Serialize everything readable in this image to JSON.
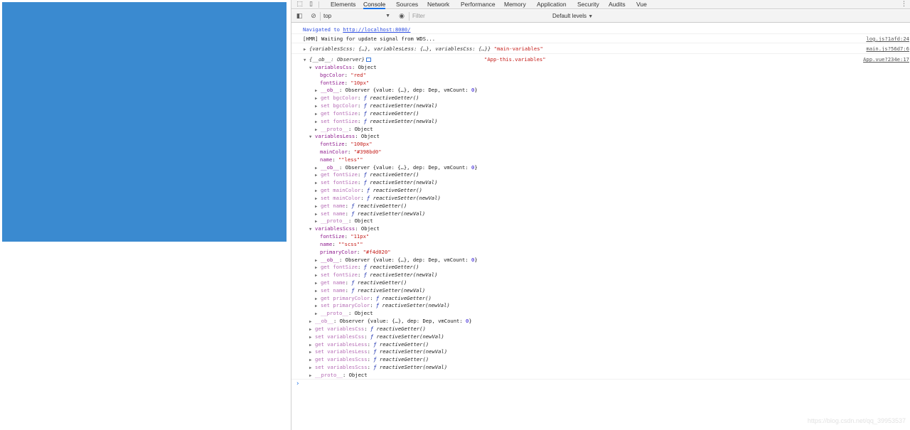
{
  "page": {
    "box_color": "#3a8ad0"
  },
  "devtools": {
    "tabs": [
      "Elements",
      "Console",
      "Sources",
      "Network",
      "Performance",
      "Memory",
      "Application",
      "Security",
      "Audits",
      "Vue"
    ],
    "active_tab": "Console",
    "toolbar": {
      "context": "top",
      "filter_placeholder": "Filter",
      "levels": "Default levels"
    }
  },
  "console": {
    "navigated": {
      "text": "Navigated to ",
      "url": "http://localhost:8080/"
    },
    "hmr": {
      "text": "[HMR] Waiting for update signal from WDS...",
      "source": "log.js?1afd:24"
    },
    "main_log": {
      "summary": "{variablesScss: {…}, variablesLess: {…}, variablesCss: {…}}",
      "label": "\"main-variables\"",
      "source": "main.js?56d7:6"
    },
    "app_log": {
      "summary": "{__ob__: Observer}",
      "label": "\"App-this.variables\"",
      "source": "App.vue?234e:17"
    },
    "tree": [
      {
        "indent": 1,
        "tri": "open",
        "key": "variablesCss",
        "value": ": Object"
      },
      {
        "indent": 2,
        "key": "bgcColor",
        "value": ": ",
        "str": "\"red\""
      },
      {
        "indent": 2,
        "key": "fontSize",
        "value": ": ",
        "str": "\"10px\""
      },
      {
        "indent": 2,
        "tri": "closed",
        "key": "__ob__",
        "value": ": Observer {value: {…}, dep: Dep, vmCount: ",
        "num": "0",
        "after": "}"
      },
      {
        "indent": 2,
        "tri": "closed",
        "dim": "get bgcColor",
        "value": ": ",
        "fsym": "ƒ",
        "fn": " reactiveGetter()"
      },
      {
        "indent": 2,
        "tri": "closed",
        "dim": "set bgcColor",
        "value": ": ",
        "fsym": "ƒ",
        "fn": " reactiveSetter(newVal)"
      },
      {
        "indent": 2,
        "tri": "closed",
        "dim": "get fontSize",
        "value": ": ",
        "fsym": "ƒ",
        "fn": " reactiveGetter()"
      },
      {
        "indent": 2,
        "tri": "closed",
        "dim": "set fontSize",
        "value": ": ",
        "fsym": "ƒ",
        "fn": " reactiveSetter(newVal)"
      },
      {
        "indent": 2,
        "tri": "closed",
        "dim": "__proto__",
        "value": ": Object"
      },
      {
        "indent": 1,
        "tri": "open",
        "key": "variablesLess",
        "value": ": Object"
      },
      {
        "indent": 2,
        "key": "fontSize",
        "value": ": ",
        "str": "\"100px\""
      },
      {
        "indent": 2,
        "key": "mainColor",
        "value": ": ",
        "str": "\"#398bd0\""
      },
      {
        "indent": 2,
        "key": "name",
        "value": ": ",
        "str": "\"\"less\"\""
      },
      {
        "indent": 2,
        "tri": "closed",
        "key": "__ob__",
        "value": ": Observer {value: {…}, dep: Dep, vmCount: ",
        "num": "0",
        "after": "}"
      },
      {
        "indent": 2,
        "tri": "closed",
        "dim": "get fontSize",
        "value": ": ",
        "fsym": "ƒ",
        "fn": " reactiveGetter()"
      },
      {
        "indent": 2,
        "tri": "closed",
        "dim": "set fontSize",
        "value": ": ",
        "fsym": "ƒ",
        "fn": " reactiveSetter(newVal)"
      },
      {
        "indent": 2,
        "tri": "closed",
        "dim": "get mainColor",
        "value": ": ",
        "fsym": "ƒ",
        "fn": " reactiveGetter()"
      },
      {
        "indent": 2,
        "tri": "closed",
        "dim": "set mainColor",
        "value": ": ",
        "fsym": "ƒ",
        "fn": " reactiveSetter(newVal)"
      },
      {
        "indent": 2,
        "tri": "closed",
        "dim": "get name",
        "value": ": ",
        "fsym": "ƒ",
        "fn": " reactiveGetter()"
      },
      {
        "indent": 2,
        "tri": "closed",
        "dim": "set name",
        "value": ": ",
        "fsym": "ƒ",
        "fn": " reactiveSetter(newVal)"
      },
      {
        "indent": 2,
        "tri": "closed",
        "dim": "__proto__",
        "value": ": Object"
      },
      {
        "indent": 1,
        "tri": "open",
        "key": "variablesScss",
        "value": ": Object"
      },
      {
        "indent": 2,
        "key": "fontSize",
        "value": ": ",
        "str": "\"11px\""
      },
      {
        "indent": 2,
        "key": "name",
        "value": ": ",
        "str": "\"\"scss\"\""
      },
      {
        "indent": 2,
        "key": "primaryColor",
        "value": ": ",
        "str": "\"#f4d020\""
      },
      {
        "indent": 2,
        "tri": "closed",
        "key": "__ob__",
        "value": ": Observer {value: {…}, dep: Dep, vmCount: ",
        "num": "0",
        "after": "}"
      },
      {
        "indent": 2,
        "tri": "closed",
        "dim": "get fontSize",
        "value": ": ",
        "fsym": "ƒ",
        "fn": " reactiveGetter()"
      },
      {
        "indent": 2,
        "tri": "closed",
        "dim": "set fontSize",
        "value": ": ",
        "fsym": "ƒ",
        "fn": " reactiveSetter(newVal)"
      },
      {
        "indent": 2,
        "tri": "closed",
        "dim": "get name",
        "value": ": ",
        "fsym": "ƒ",
        "fn": " reactiveGetter()"
      },
      {
        "indent": 2,
        "tri": "closed",
        "dim": "set name",
        "value": ": ",
        "fsym": "ƒ",
        "fn": " reactiveSetter(newVal)"
      },
      {
        "indent": 2,
        "tri": "closed",
        "dim": "get primaryColor",
        "value": ": ",
        "fsym": "ƒ",
        "fn": " reactiveGetter()"
      },
      {
        "indent": 2,
        "tri": "closed",
        "dim": "set primaryColor",
        "value": ": ",
        "fsym": "ƒ",
        "fn": " reactiveSetter(newVal)"
      },
      {
        "indent": 2,
        "tri": "closed",
        "dim": "__proto__",
        "value": ": Object"
      },
      {
        "indent": 1,
        "tri": "closed",
        "dim": "__ob__",
        "value": ": Observer {value: {…}, dep: Dep, vmCount: ",
        "num": "0",
        "after": "}"
      },
      {
        "indent": 1,
        "tri": "closed",
        "dim": "get variablesCss",
        "value": ": ",
        "fsym": "ƒ",
        "fn": " reactiveGetter()"
      },
      {
        "indent": 1,
        "tri": "closed",
        "dim": "set variablesCss",
        "value": ": ",
        "fsym": "ƒ",
        "fn": " reactiveSetter(newVal)"
      },
      {
        "indent": 1,
        "tri": "closed",
        "dim": "get variablesLess",
        "value": ": ",
        "fsym": "ƒ",
        "fn": " reactiveGetter()"
      },
      {
        "indent": 1,
        "tri": "closed",
        "dim": "set variablesLess",
        "value": ": ",
        "fsym": "ƒ",
        "fn": " reactiveSetter(newVal)"
      },
      {
        "indent": 1,
        "tri": "closed",
        "dim": "get variablesScss",
        "value": ": ",
        "fsym": "ƒ",
        "fn": " reactiveGetter()"
      },
      {
        "indent": 1,
        "tri": "closed",
        "dim": "set variablesScss",
        "value": ": ",
        "fsym": "ƒ",
        "fn": " reactiveSetter(newVal)"
      },
      {
        "indent": 1,
        "tri": "closed",
        "dim": "__proto__",
        "value": ": Object"
      }
    ],
    "prompt": "›"
  },
  "watermark": "https://blog.csdn.net/qq_39953537"
}
